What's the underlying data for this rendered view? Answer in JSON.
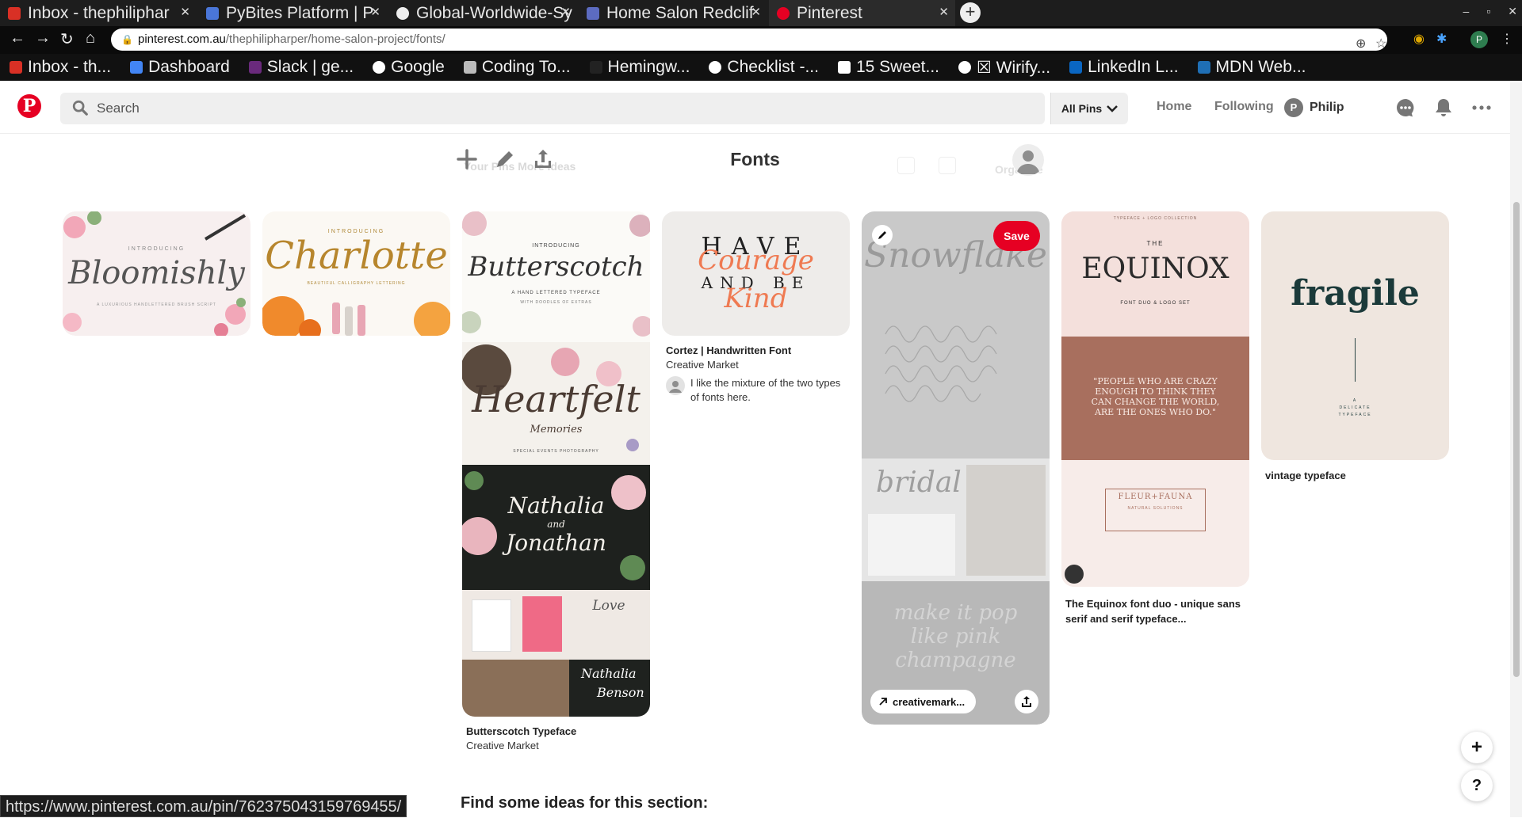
{
  "browser": {
    "tabs": [
      {
        "label": "Inbox - thephiliphar",
        "color": "#d93025"
      },
      {
        "label": "PyBites Platform | P",
        "color": "#4a76d8"
      },
      {
        "label": "Global-Worldwide-Sy",
        "color": "#eeeeee"
      },
      {
        "label": "Home Salon Redclif",
        "color": "#5c6bc0"
      },
      {
        "label": "Pinterest",
        "color": "#e60023"
      }
    ],
    "new_tab_symbol": "+",
    "window_controls": [
      "–",
      "▫",
      "✕"
    ],
    "url_host": "pinterest.com.au",
    "url_path": "/thephilipharper/home-salon-project/fonts/",
    "profile_initial": "P",
    "bookmarks": [
      {
        "label": "Inbox - th...",
        "color": "#d93025"
      },
      {
        "label": "Dashboard",
        "color": "#4285f4"
      },
      {
        "label": "Slack | ge...",
        "color": "#6a2a7c"
      },
      {
        "label": "Google",
        "color": "#ffffff"
      },
      {
        "label": "Coding To...",
        "color": "#bbbbbb"
      },
      {
        "label": "Hemingw...",
        "color": "#222222"
      },
      {
        "label": "Checklist -...",
        "color": "#ffffff"
      },
      {
        "label": "15 Sweet...",
        "color": "#ffffff"
      },
      {
        "label": "☒ Wirify...",
        "color": "#ffffff"
      },
      {
        "label": "LinkedIn L...",
        "color": "#0a66c2"
      },
      {
        "label": "MDN Web...",
        "color": "#1f6fb5"
      }
    ],
    "status_url": "https://www.pinterest.com.au/pin/762375043159769455/"
  },
  "pinterest": {
    "logo": "P",
    "search_placeholder": "Search",
    "all_pins_label": "All Pins",
    "nav": {
      "home": "Home",
      "following": "Following",
      "user_name": "Philip",
      "user_initial": "P"
    },
    "accent": "#e60023"
  },
  "board": {
    "title": "Fonts",
    "ghost_tabs": "Your Pins    More ideas",
    "ghost_organise": "Organise"
  },
  "pins": [
    {
      "art": "Bloomishly",
      "art_top": "INTRODUCING",
      "art_sub": "A LUXURIOUS HANDLETTERED BRUSH SCRIPT"
    },
    {
      "art": "Charlotte",
      "art_top": "INTRODUCING",
      "art_sub": "BEAUTIFUL CALLIGRAPHY LETTERING"
    },
    {
      "art1": "Butterscotch",
      "art1_top": "INTRODUCING",
      "art1_sub": "A HAND LETTERED TYPEFACE",
      "art1_sub2": "WITH DOODLES OF EXTRAS",
      "art2": "Heartfelt",
      "art2_sub": "Memories",
      "art2_sub2": "SPECIAL EVENTS PHOTOGRAPHY",
      "art3_a": "Nathalia",
      "art3_and": "and",
      "art3_b": "Jonathan",
      "art4_a": "Love",
      "art4_b": "Nathalia",
      "art4_c": "Benson",
      "title": "Butterscotch Typeface",
      "source": "Creative Market"
    },
    {
      "art_line1": "HAVE",
      "art_script1": "Courage",
      "art_line2": "AND BE",
      "art_script2": "Kind",
      "title": "Cortez | Handwritten Font",
      "source": "Creative Market",
      "comment": "I like the mixture of the two types of fonts here."
    },
    {
      "art1": "Snowflake",
      "art2": "bridal",
      "art3": "make it pop like pink champagne",
      "save_label": "Save",
      "link_label": "creativemark..."
    },
    {
      "art_top": "TYPEFACE + LOGO COLLECTION",
      "art_the": "THE",
      "art": "EQUINOX",
      "art_sub": "FONT DUO & LOGO SET",
      "quote": "\"PEOPLE WHO ARE CRAZY ENOUGH TO THINK THEY CAN CHANGE THE WORLD, ARE THE ONES WHO DO.\"",
      "logo_text": "FLEUR+FAUNA",
      "logo_sub": "NATURAL SOLUTIONS",
      "title": "The Equinox font duo - unique sans serif and serif typeface..."
    },
    {
      "art": "fragile",
      "art_sub": "A DELICATE TYPEFACE",
      "title": "vintage typeface"
    }
  ],
  "footer": {
    "find_ideas": "Find some ideas for this section:",
    "fab_add": "+",
    "fab_help": "?"
  }
}
